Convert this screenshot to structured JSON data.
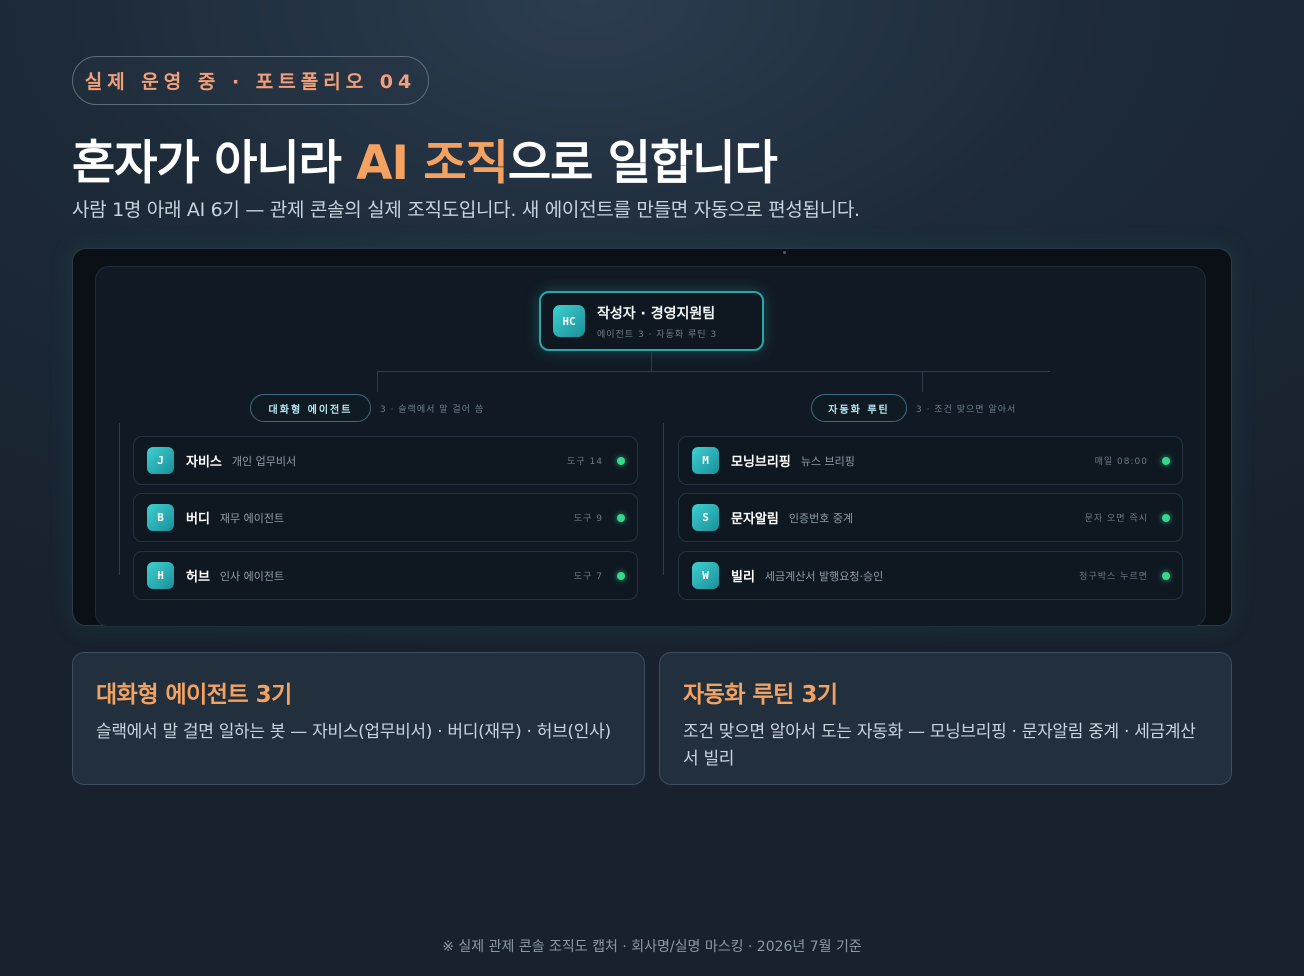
{
  "badge": "실제 운영 중 · 포트폴리오 04",
  "headline": {
    "before": "혼자가 아니라 ",
    "accent": "AI 조직",
    "after": "으로 일합니다"
  },
  "subline": "사람 1명 아래 AI 6기 — 관제 콘솔의 실제 조직도입니다. 새 에이전트를 만들면 자동으로 편성됩니다.",
  "org": {
    "root": {
      "initials": "HC",
      "title": "작성자 · 경영지원팀",
      "subtitle": "에이전트 3 · 자동화 루틴 3"
    },
    "groups": [
      {
        "label": "대화형 에이전트",
        "note": "3 · 슬랙에서 말 걸어 씀",
        "items": [
          {
            "initial": "J",
            "name": "자비스",
            "role": "개인 업무비서",
            "meta": "도구 14"
          },
          {
            "initial": "B",
            "name": "버디",
            "role": "재무 에이전트",
            "meta": "도구 9"
          },
          {
            "initial": "H",
            "name": "허브",
            "role": "인사 에이전트",
            "meta": "도구 7"
          }
        ]
      },
      {
        "label": "자동화 루틴",
        "note": "3 · 조건 맞으면 알아서",
        "items": [
          {
            "initial": "M",
            "name": "모닝브리핑",
            "role": "뉴스 브리핑",
            "meta": "매일 08:00"
          },
          {
            "initial": "S",
            "name": "문자알림",
            "role": "인증번호 중계",
            "meta": "문자 오면 즉시"
          },
          {
            "initial": "W",
            "name": "빌리",
            "role": "세금계산서 발행요청·승인",
            "meta": "청구박스 누르면"
          }
        ]
      }
    ]
  },
  "summary": [
    {
      "title": "대화형 에이전트 3기",
      "body": "슬랙에서 말 걸면 일하는 봇 — 자비스(업무비서) · 버디(재무) · 허브(인사)"
    },
    {
      "title": "자동화 루틴 3기",
      "body": "조건 맞으면 알아서 도는 자동화 — 모닝브리핑 · 문자알림 중계 · 세금계산서 빌리"
    }
  ],
  "footer": "※ 실제 관제 콘솔 조직도 캡처 · 회사명/실명 마스킹 · 2026년 7월 기준",
  "colors": {
    "accent": "#f4a261",
    "teal": "#2aa6a8",
    "status": "#38d68e",
    "badge_text": "#f2a07a"
  }
}
